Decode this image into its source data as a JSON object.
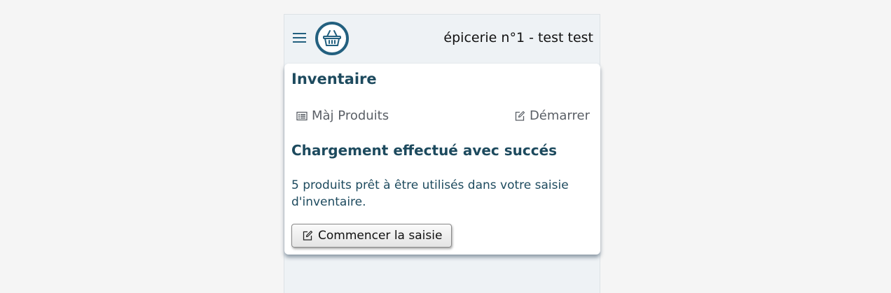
{
  "header": {
    "menu_icon": "hamburger-menu-icon",
    "logo_icon": "shopping-basket-icon",
    "store_title": "épicerie n°1 - test test"
  },
  "card": {
    "title": "Inventaire",
    "actions": {
      "update_products": {
        "label": "Màj Produits",
        "icon": "list-icon"
      },
      "start": {
        "label": "Démarrer",
        "icon": "edit-icon"
      }
    },
    "status_title": "Chargement effectué avec succés",
    "message": "5 produits prêt à être utilisés dans votre saisie d'inventaire.",
    "start_entry_button": {
      "label": "Commencer la saisie",
      "icon": "edit-icon"
    }
  },
  "colors": {
    "accent": "#23607f",
    "heading": "#1d4a5e",
    "background": "#eef2f5"
  }
}
